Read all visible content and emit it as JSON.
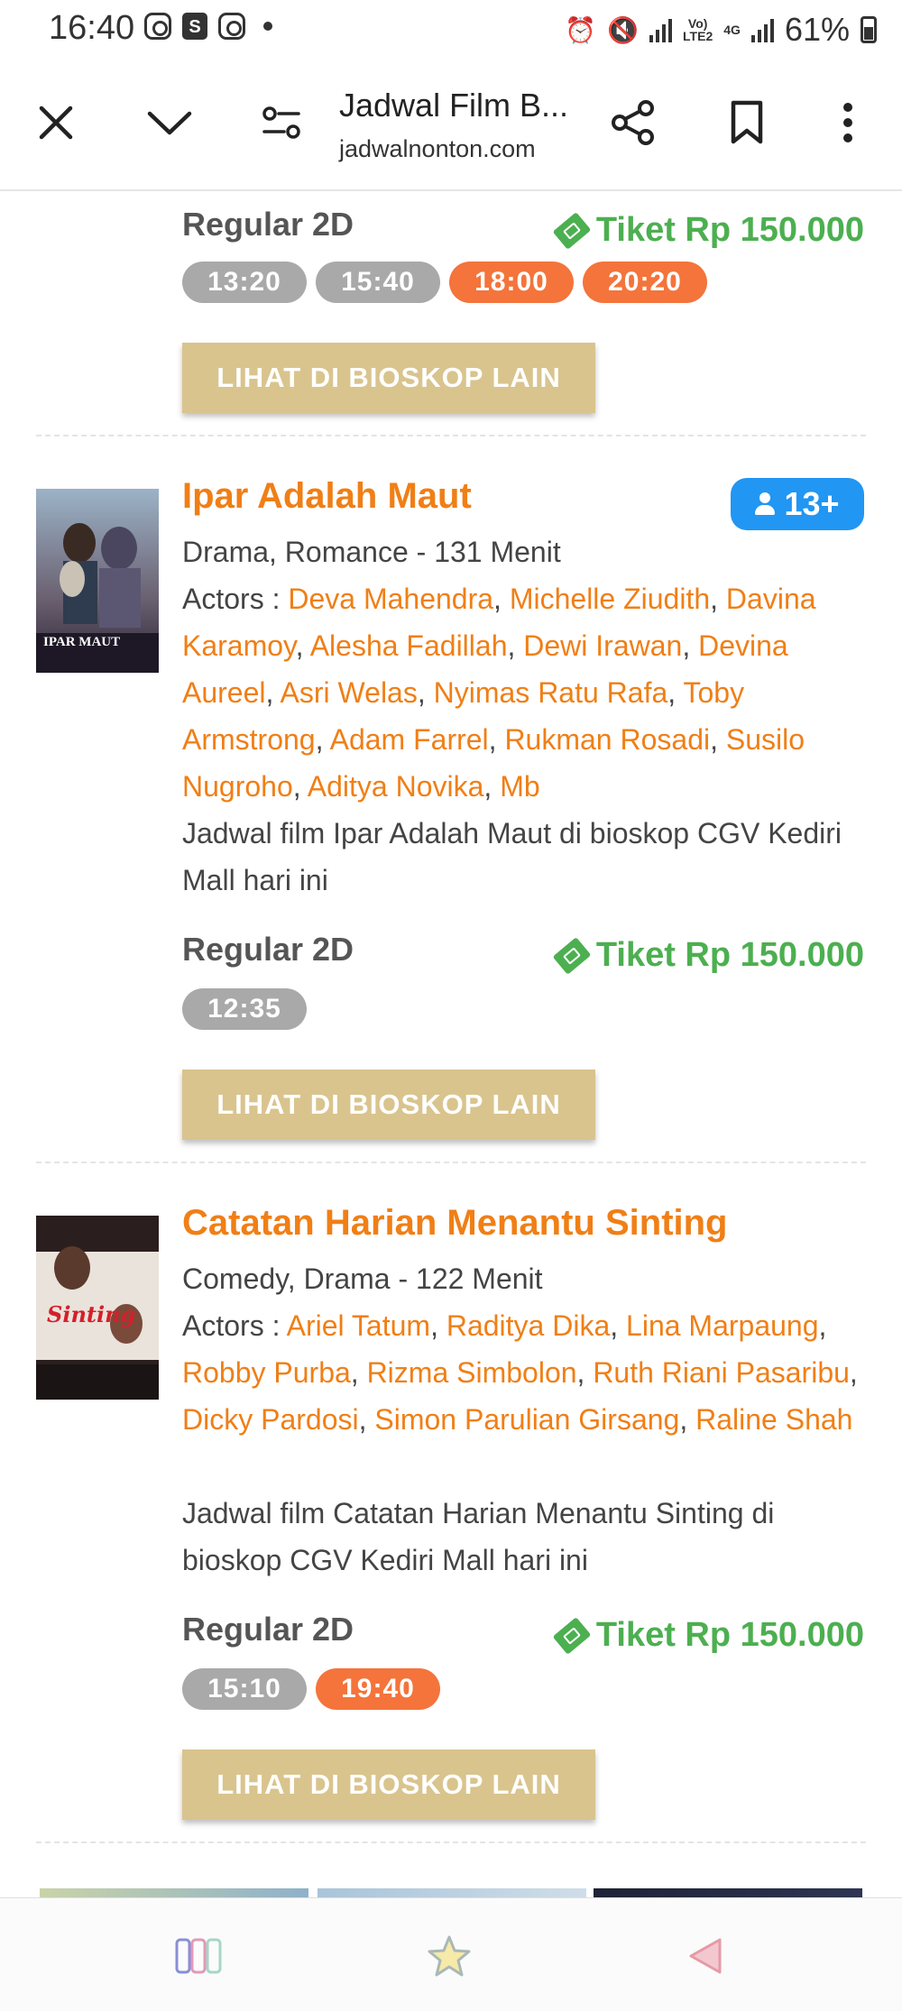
{
  "status_bar": {
    "time": "16:40",
    "battery": "61%",
    "network_label_top": "Vo)",
    "network_label_bottom": "LTE2",
    "network_gen": "4G"
  },
  "toolbar": {
    "title": "Jadwal Film B...",
    "url": "jadwalnonton.com"
  },
  "top_partial": {
    "format": "Regular 2D",
    "price": "Tiket Rp 150.000",
    "times": [
      {
        "label": "13:20",
        "state": "past"
      },
      {
        "label": "15:40",
        "state": "past"
      },
      {
        "label": "18:00",
        "state": "open"
      },
      {
        "label": "20:20",
        "state": "open"
      }
    ],
    "other_button": "LIHAT DI BIOSKOP LAIN"
  },
  "movies": [
    {
      "title": "Ipar Adalah Maut",
      "rating": "13+",
      "genre": "Drama, Romance - 131 Menit",
      "actors_label": "Actors : ",
      "actors": [
        "Deva Mahendra",
        "Michelle Ziudith",
        "Davina Karamoy",
        "Alesha Fadillah",
        "Dewi Irawan",
        "Devina Aureel",
        "Asri Welas",
        "Nyimas Ratu Rafa",
        "Toby Armstrong",
        "Adam Farrel",
        "Rukman Rosadi",
        "Susilo Nugroho",
        "Aditya Novika",
        "Mb"
      ],
      "description": "Jadwal film Ipar Adalah Maut di bioskop CGV Kediri Mall hari ini",
      "format": "Regular 2D",
      "price": "Tiket Rp 150.000",
      "times": [
        {
          "label": "12:35",
          "state": "past"
        }
      ],
      "other_button": "LIHAT DI BIOSKOP LAIN",
      "poster_text": "IPAR MAUT"
    },
    {
      "title": "Catatan Harian Menantu Sinting",
      "genre": "Comedy, Drama - 122 Menit",
      "actors_label": "Actors : ",
      "actors": [
        "Ariel Tatum",
        "Raditya Dika",
        "Lina Marpaung",
        "Robby Purba",
        "Rizma Simbolon",
        "Ruth Riani Pasaribu",
        "Dicky Pardosi",
        "Simon Parulian Girsang",
        "Raline Shah"
      ],
      "description": "Jadwal film Catatan Harian Menantu Sinting di bioskop CGV Kediri Mall hari ini",
      "format": "Regular 2D",
      "price": "Tiket Rp 150.000",
      "times": [
        {
          "label": "15:10",
          "state": "past"
        },
        {
          "label": "19:40",
          "state": "open"
        }
      ],
      "other_button": "LIHAT DI BIOSKOP LAIN"
    }
  ],
  "colors": {
    "accent_orange": "#f07f16",
    "price_green": "#4caf50",
    "time_past": "#a9a9a9",
    "time_open": "#f4743b",
    "button_tan": "#d9c48e",
    "rating_blue": "#2196f3"
  },
  "bottom_nav": {
    "icons": [
      "tabs-icon",
      "bookmarks-star-icon",
      "back-icon"
    ]
  }
}
